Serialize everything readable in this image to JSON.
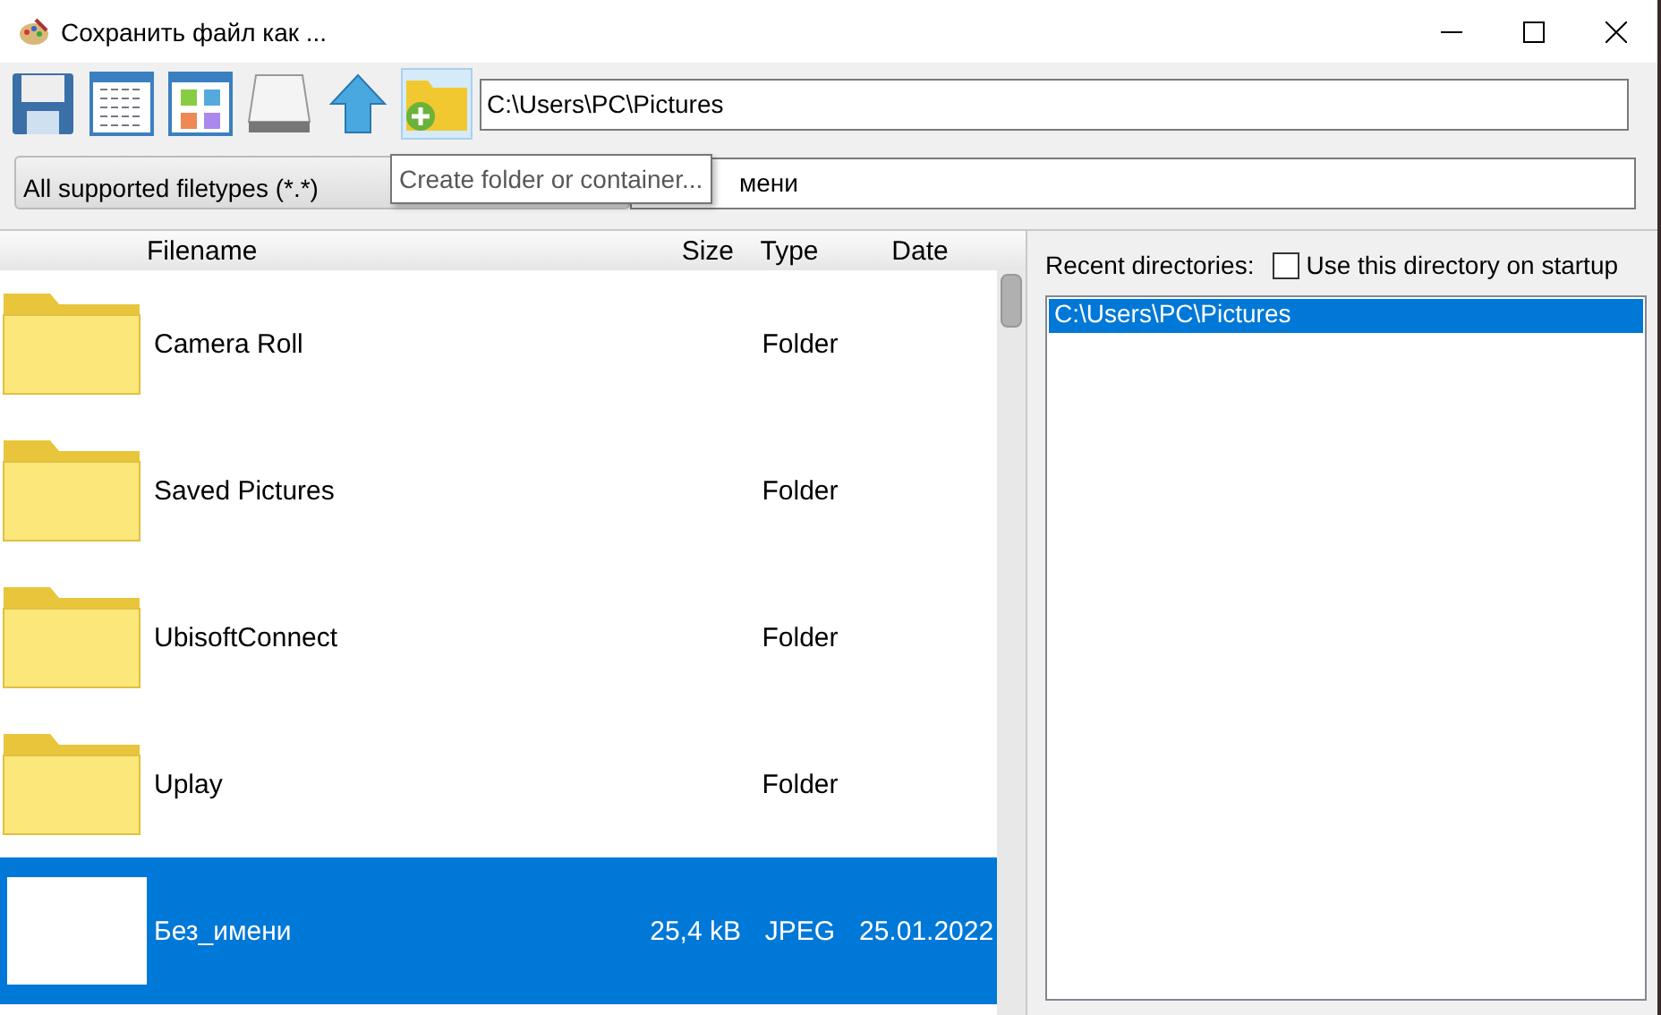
{
  "window": {
    "title": "Сохранить файл как ..."
  },
  "path_field": {
    "value": "C:\\Users\\PC\\Pictures"
  },
  "filter_dropdown": {
    "value": "All supported filetypes (*.*)"
  },
  "filename_field": {
    "value": "мени"
  },
  "tooltip": {
    "text": "Create folder or container..."
  },
  "table": {
    "columns": [
      "Filename",
      "Size",
      "Type",
      "Date"
    ],
    "rows": [
      {
        "kind": "folder",
        "name": "Camera Roll",
        "size": "",
        "type": "Folder",
        "date": "",
        "selected": false
      },
      {
        "kind": "folder",
        "name": "Saved Pictures",
        "size": "",
        "type": "Folder",
        "date": "",
        "selected": false
      },
      {
        "kind": "folder",
        "name": "UbisoftConnect",
        "size": "",
        "type": "Folder",
        "date": "",
        "selected": false
      },
      {
        "kind": "folder",
        "name": "Uplay",
        "size": "",
        "type": "Folder",
        "date": "",
        "selected": false
      },
      {
        "kind": "image",
        "name": "Без_имени",
        "size": "25,4 kB",
        "type": "JPEG",
        "date": "25.01.2022",
        "selected": true
      }
    ]
  },
  "recent": {
    "label": "Recent directories:",
    "startup_checkbox": {
      "label": "Use this directory on startup",
      "checked": false
    },
    "items": [
      {
        "text": "C:\\Users\\PC\\Pictures",
        "selected": true
      }
    ]
  }
}
